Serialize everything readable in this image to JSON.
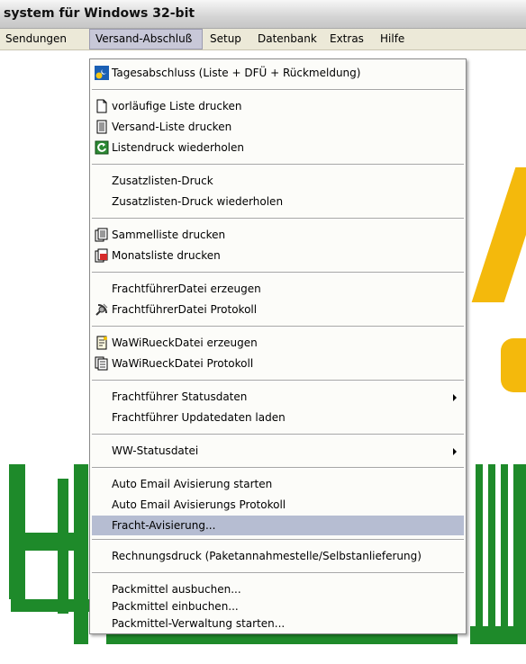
{
  "window": {
    "title": "system für Windows 32-bit"
  },
  "menubar": [
    {
      "label": "Sendungen"
    },
    {
      "label": "Versand-Abschluß"
    },
    {
      "label": "Setup"
    },
    {
      "label": "Datenbank"
    },
    {
      "label": "Extras"
    },
    {
      "label": "Hilfe"
    }
  ],
  "dropdown": {
    "items": [
      {
        "label": "Tagesabschluss (Liste + DFÜ + Rückmeldung)",
        "icon": "day-close-icon"
      },
      {
        "label": "vorläufige Liste drucken",
        "icon": "blank-document-icon"
      },
      {
        "label": "Versand-Liste drucken",
        "icon": "list-document-icon"
      },
      {
        "label": "Listendruck wiederholen",
        "icon": "repeat-print-icon"
      },
      {
        "label": "Zusatzlisten-Druck"
      },
      {
        "label": "Zusatzlisten-Druck wiederholen"
      },
      {
        "label": "Sammelliste drucken",
        "icon": "collect-list-icon"
      },
      {
        "label": "Monatsliste drucken",
        "icon": "month-list-icon"
      },
      {
        "label": "FrachtführerDatei erzeugen"
      },
      {
        "label": "FrachtführerDatei Protokoll",
        "icon": "satellite-icon"
      },
      {
        "label": "WaWiRueckDatei erzeugen",
        "icon": "doc-create-icon"
      },
      {
        "label": "WaWiRueckDatei Protokoll",
        "icon": "doc-stack-icon"
      },
      {
        "label": "Frachtführer Statusdaten",
        "submenu": true
      },
      {
        "label": "Frachtführer Updatedaten laden"
      },
      {
        "label": "WW-Statusdatei",
        "submenu": true
      },
      {
        "label": "Auto Email Avisierung starten"
      },
      {
        "label": "Auto Email Avisierungs Protokoll"
      },
      {
        "label": "Fracht-Avisierung...",
        "highlighted": true
      },
      {
        "label": "Rechnungsdruck (Paketannahmestelle/Selbstanlieferung)"
      },
      {
        "label": "Packmittel ausbuchen..."
      },
      {
        "label": "Packmittel einbuchen..."
      },
      {
        "label": "Packmittel-Verwaltung starten..."
      }
    ]
  },
  "colors": {
    "brand_green": "#1e8a2a",
    "brand_yellow": "#f4b90c",
    "highlight": "#b6bdd2"
  }
}
